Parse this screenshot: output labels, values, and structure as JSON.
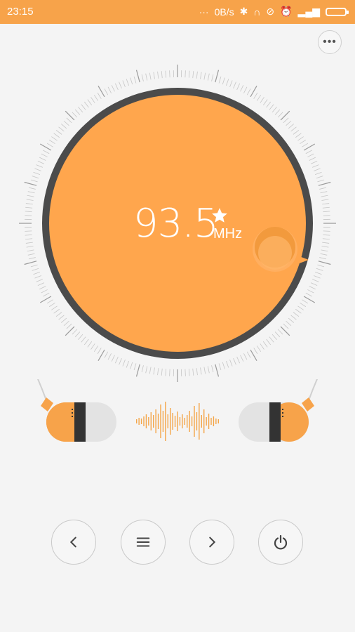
{
  "status_bar": {
    "time": "23:15",
    "network_speed": "0B/s",
    "icons": [
      "bluetooth-icon",
      "headphones-icon",
      "mute-icon",
      "alarm-icon",
      "signal-icon",
      "signal-icon",
      "battery-icon"
    ]
  },
  "menu": {
    "more_label": "•••"
  },
  "tuner": {
    "frequency": "93.5",
    "unit": "MHz",
    "favorite_icon": "star-icon",
    "accent_color": "#ffa64d",
    "ring_color": "#4b4b4b"
  },
  "controls": [
    {
      "name": "previous-button",
      "icon": "chevron-left-icon"
    },
    {
      "name": "station-list-button",
      "icon": "menu-icon"
    },
    {
      "name": "next-button",
      "icon": "chevron-right-icon"
    },
    {
      "name": "power-button",
      "icon": "power-icon"
    }
  ]
}
